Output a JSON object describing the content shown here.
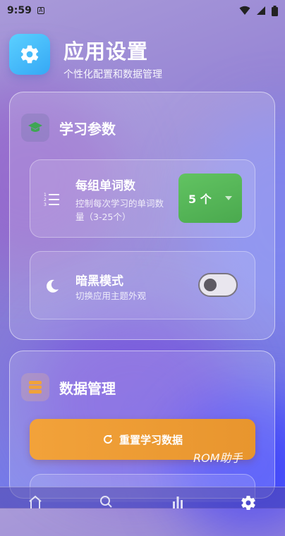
{
  "status_bar": {
    "time": "9:59",
    "app_badge": "A"
  },
  "header": {
    "title": "应用设置",
    "subtitle": "个性化配置和数据管理",
    "icon": "gear-icon"
  },
  "sections": {
    "learning": {
      "title": "学习参数",
      "icon": "graduation-cap-icon",
      "words_per_group": {
        "title": "每组单词数",
        "description_line1": "控制每次学习的单词数",
        "description_line2": "量（3-25个）",
        "icon": "numbered-list-icon",
        "selected_value": "5 个"
      },
      "dark_mode": {
        "title": "暗黑模式",
        "description": "切换应用主题外观",
        "icon": "moon-icon",
        "enabled": false
      }
    },
    "data": {
      "title": "数据管理",
      "icon": "database-icon",
      "reset_button": {
        "label": "重置学习数据",
        "icon": "refresh-icon"
      }
    }
  },
  "watermark": "ROM助手",
  "bottom_nav": {
    "items": [
      {
        "name": "home",
        "icon": "home-icon"
      },
      {
        "name": "search",
        "icon": "search-icon"
      },
      {
        "name": "stats",
        "icon": "bar-chart-icon"
      },
      {
        "name": "settings",
        "icon": "gear-icon",
        "active": true
      }
    ]
  },
  "colors": {
    "accent_blue": "#35a8f5",
    "dropdown_green": "#4aa94e",
    "reset_orange": "#e8952e"
  }
}
